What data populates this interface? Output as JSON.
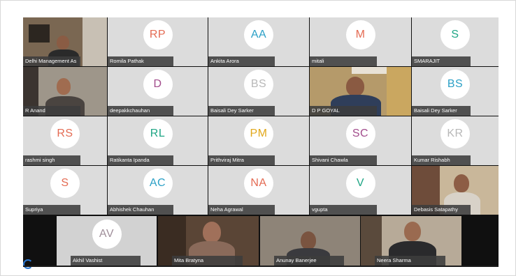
{
  "participants": [
    {
      "name": "Delhi Management As",
      "initials": "",
      "video": true
    },
    {
      "name": "Romila Pathak",
      "initials": "RP",
      "color": "#e46b53",
      "video": false
    },
    {
      "name": "Ankita Arora",
      "initials": "AA",
      "color": "#2ba0c6",
      "video": false
    },
    {
      "name": "mitali",
      "initials": "M",
      "color": "#e46b53",
      "video": false
    },
    {
      "name": "SMARAJIT",
      "initials": "S",
      "color": "#1ea584",
      "video": false
    },
    {
      "name": "R Anand",
      "initials": "",
      "video": true
    },
    {
      "name": "deepakkchauhan",
      "initials": "D",
      "color": "#a24c8c",
      "video": false
    },
    {
      "name": "Baisali Dey Sarker",
      "initials": "BS",
      "color": "#b8b8b8",
      "video": false
    },
    {
      "name": "D P GOYAL",
      "initials": "",
      "video": true
    },
    {
      "name": "Baisali Dey Sarker",
      "initials": "BS",
      "color": "#2ba0c6",
      "video": false
    },
    {
      "name": "rashmi singh",
      "initials": "RS",
      "color": "#e46b53",
      "video": false
    },
    {
      "name": "Ratikanta Ipanda",
      "initials": "RL",
      "color": "#1ea584",
      "video": false
    },
    {
      "name": "Prithviraj Mitra",
      "initials": "PM",
      "color": "#e1a81b",
      "video": false
    },
    {
      "name": "Shivani Chawla",
      "initials": "SC",
      "color": "#a24c8c",
      "video": false
    },
    {
      "name": "Kumar Rishabh",
      "initials": "KR",
      "color": "#b8b8b8",
      "video": false
    },
    {
      "name": "Supriya",
      "initials": "S",
      "color": "#e46b53",
      "video": false
    },
    {
      "name": "Abhishek Chauhan",
      "initials": "AC",
      "color": "#2ba0c6",
      "video": false
    },
    {
      "name": "Neha Agrawal",
      "initials": "NA",
      "color": "#e46b53",
      "video": false
    },
    {
      "name": "vgupta",
      "initials": "V",
      "color": "#1ea584",
      "video": false
    },
    {
      "name": "Debasis Satapathy",
      "initials": "",
      "video": true
    },
    {
      "name": "Akhil Vashist",
      "initials": "AV",
      "color": "#a08f9a",
      "video": false
    },
    {
      "name": "Mita Bratyna",
      "initials": "",
      "video": true
    },
    {
      "name": "Anunay Banerjee",
      "initials": "",
      "video": true
    },
    {
      "name": "Neera Sharma",
      "initials": "",
      "video": true
    }
  ]
}
